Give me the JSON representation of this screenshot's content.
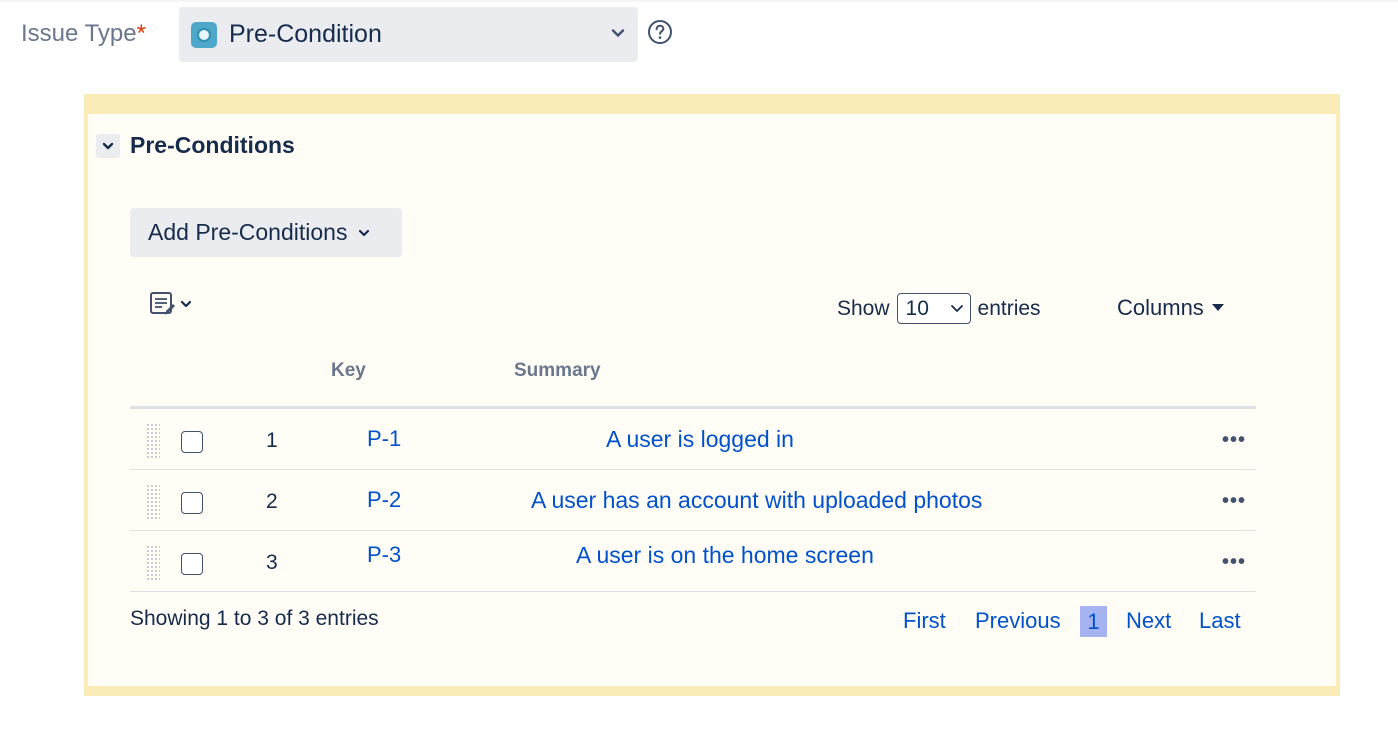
{
  "issue_type": {
    "label": "Issue Type",
    "required_marker": "*",
    "value": "Pre-Condition",
    "icon": "pre-condition-icon"
  },
  "section": {
    "title": "Pre-Conditions",
    "add_button_label": "Add Pre-Conditions"
  },
  "table_controls": {
    "show_label": "Show",
    "entries_label": "entries",
    "page_size": "10",
    "columns_label": "Columns"
  },
  "columns": {
    "key": "Key",
    "summary": "Summary"
  },
  "rows": [
    {
      "num": "1",
      "key": "P-1",
      "summary": "A user is logged in"
    },
    {
      "num": "2",
      "key": "P-2",
      "summary": "A user has an account with uploaded photos"
    },
    {
      "num": "3",
      "key": "P-3",
      "summary": "A user is on the home screen"
    }
  ],
  "footer": {
    "showing_text": "Showing 1 to 3 of 3 entries",
    "pagination": {
      "first": "First",
      "previous": "Previous",
      "current": "1",
      "next": "Next",
      "last": "Last"
    }
  },
  "colors": {
    "panel_border": "#faecb6",
    "link": "#0052cc",
    "current_page_bg": "#a5b4f0"
  }
}
